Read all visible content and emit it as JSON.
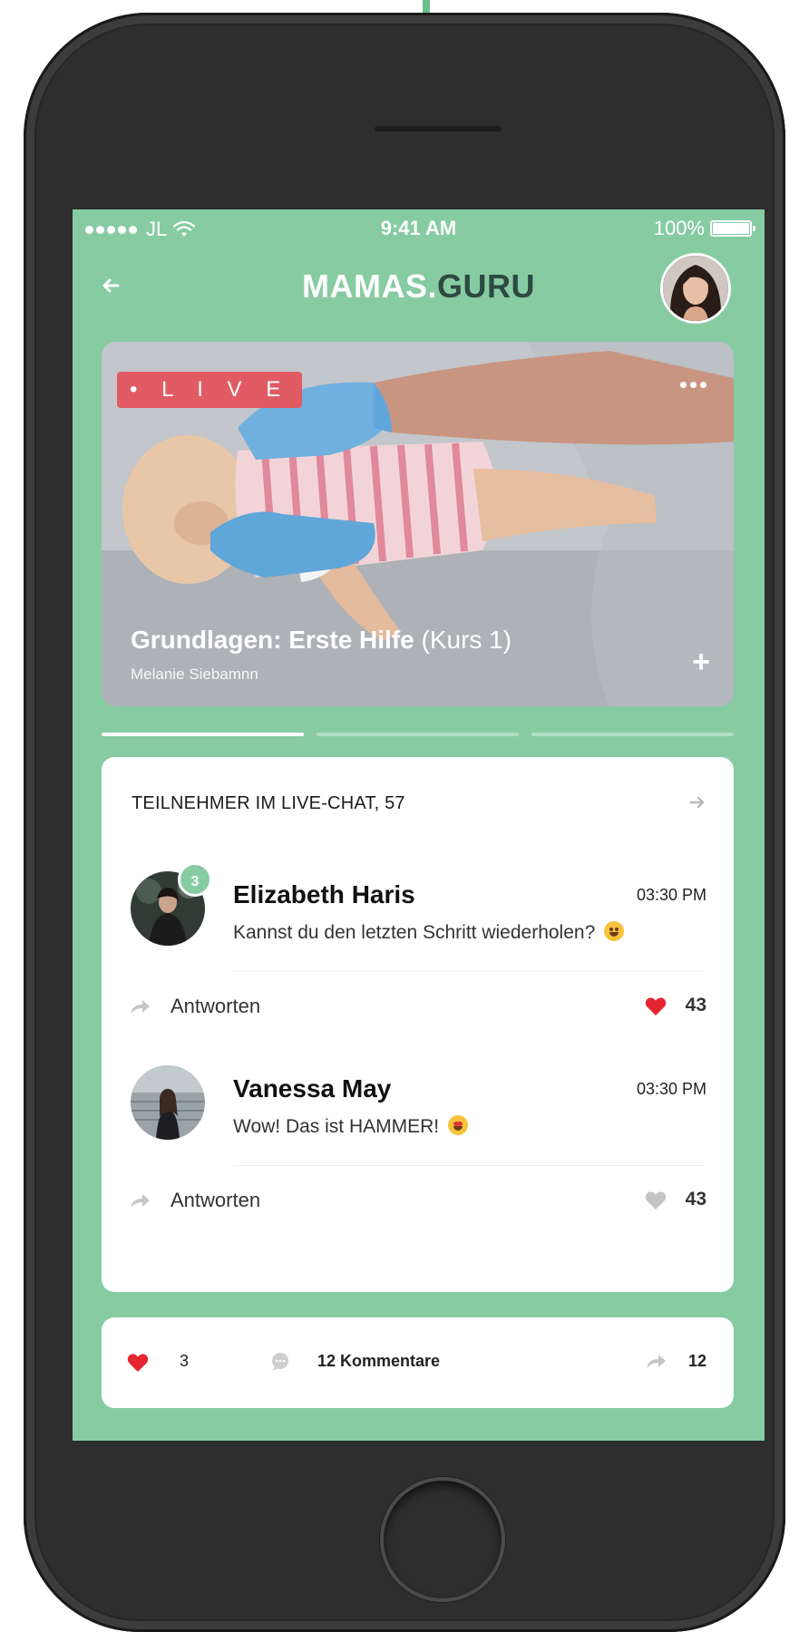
{
  "status_bar": {
    "carrier": "JL",
    "time": "9:41 AM",
    "battery_text": "100%",
    "battery_level": 1.0
  },
  "header": {
    "brand_part1": "MAMAS.",
    "brand_part2": "GURU",
    "back_icon": "arrow-left-icon",
    "avatar_icon": "user-avatar"
  },
  "video": {
    "live_label": "• L I V E",
    "title_bold": "Grundlagen: Erste Hilfe",
    "title_light": " (Kurs 1)",
    "instructor": "Melanie Siebamnn",
    "more_icon": "more-horizontal-icon",
    "add_label": "+"
  },
  "progress": {
    "segments": 3,
    "active_index": 0
  },
  "chat": {
    "header": "TEILNEHMER IM LIVE-CHAT, 57",
    "messages": [
      {
        "name": "Elizabeth Haris",
        "time": "03:30 PM",
        "text": "Kannst du den letzten Schritt wiederholen?",
        "badge": "3",
        "reply_label": "Antworten",
        "likes": "43",
        "liked": true
      },
      {
        "name": "Vanessa May",
        "time": "03:30 PM",
        "text": "Wow! Das ist HAMMER!",
        "badge": "",
        "reply_label": "Antworten",
        "likes": "43",
        "liked": false
      }
    ]
  },
  "footer": {
    "likes": "3",
    "comments": "12 Kommentare",
    "shares": "12"
  },
  "colors": {
    "screen_bg": "#87cba2",
    "live_red": "#e05b64",
    "heart_red": "#e3262f",
    "heart_grey": "#c4c4c4",
    "brand_dark": "#2d4a41"
  }
}
